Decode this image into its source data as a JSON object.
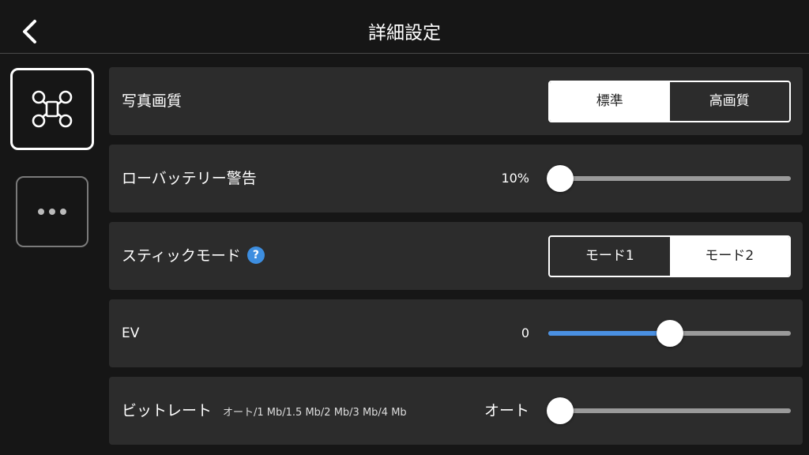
{
  "header": {
    "title": "詳細設定",
    "back_icon": "chevron-left-icon"
  },
  "sidebar": {
    "tabs": [
      {
        "icon": "drone-icon",
        "active": true
      },
      {
        "icon": "more-horizontal-icon",
        "active": false
      }
    ]
  },
  "settings": {
    "photo_quality": {
      "label": "写真画質",
      "options": [
        "標準",
        "高画質"
      ],
      "selected": "標準"
    },
    "low_battery": {
      "label": "ローバッテリー警告",
      "value_text": "10%",
      "level": 0.0
    },
    "stick_mode": {
      "label": "スティックモード",
      "help": "?",
      "options": [
        "モード1",
        "モード2"
      ],
      "selected": "モード2"
    },
    "ev": {
      "label": "EV",
      "value_text": "0",
      "level": 0.5
    },
    "bitrate": {
      "label": "ビットレート",
      "hint": "オート/1 Mb/1.5 Mb/2 Mb/3 Mb/4 Mb",
      "value_text": "オート",
      "level": 0.0
    }
  },
  "colors": {
    "accent": "#4a90e2",
    "background": "#161616",
    "row_background": "#2c2c2c",
    "help_badge": "#3d8ee0"
  }
}
